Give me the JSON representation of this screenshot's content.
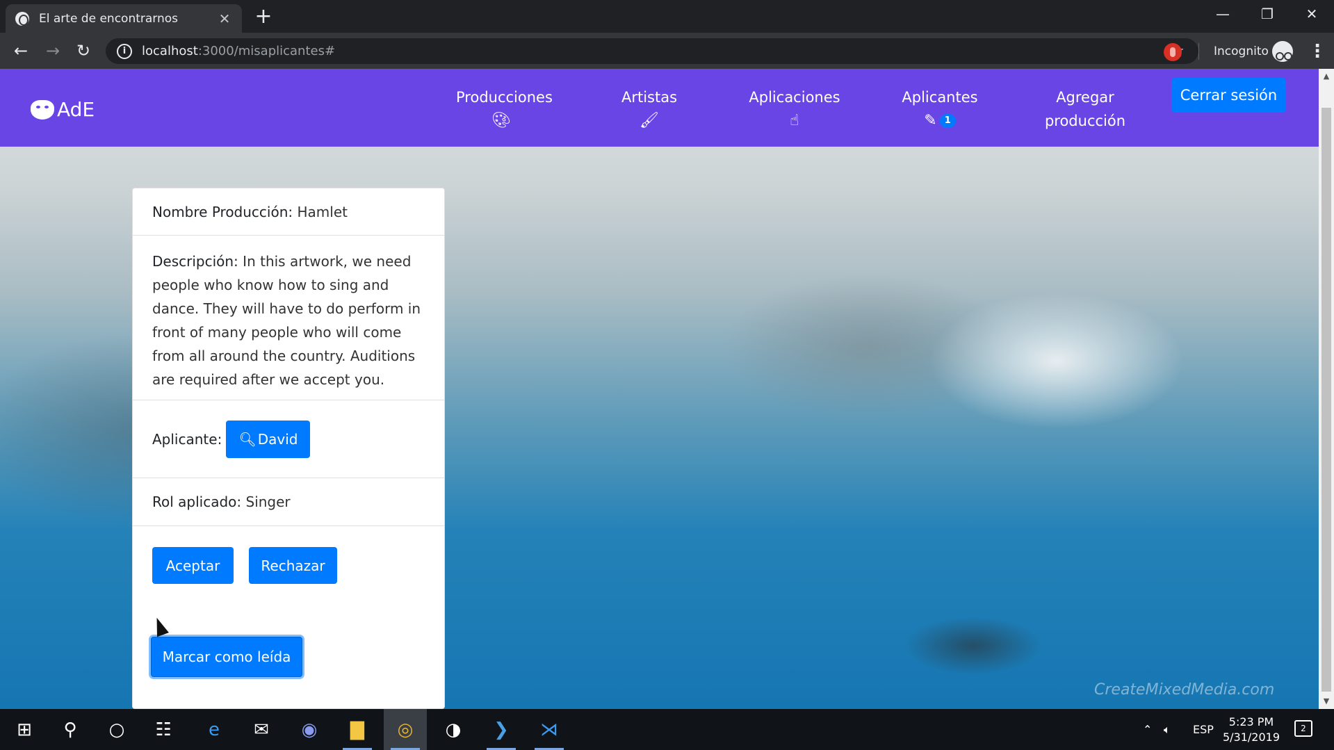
{
  "browser": {
    "tab_title": "El arte de encontrarnos",
    "url_host": "localhost",
    "url_path": ":3000/misaplicantes#",
    "incognito_label": "Incognito"
  },
  "app": {
    "brand": "AdE",
    "nav": [
      {
        "label": "Producciones",
        "icon": "palette-icon"
      },
      {
        "label": "Artistas",
        "icon": "brush-icon"
      },
      {
        "label": "Aplicaciones",
        "icon": "hand-pointer-icon"
      },
      {
        "label": "Aplicantes",
        "icon": "paint-brush-icon",
        "badge": "1"
      },
      {
        "label_line1": "Agregar",
        "label_line2": "producción"
      }
    ],
    "logout_label": "Cerrar sesión",
    "colors": {
      "navbar": "#6a45e6",
      "primary": "#007bff"
    }
  },
  "card": {
    "name_label": "Nombre Producción:",
    "name_value": "Hamlet",
    "desc_label": "Descripción:",
    "desc_value": "In this artwork, we need people who know how to sing and dance. They will have to do perform in front of many people who will come from all around the country. Auditions are required after we accept you.",
    "applicant_label": "Aplicante:",
    "applicant_button": "David",
    "role_label": "Rol aplicado:",
    "role_value": "Singer",
    "accept_label": "Aceptar",
    "reject_label": "Rechazar",
    "mark_read_label": "Marcar como leída"
  },
  "watermark": "CreateMixedMedia.com",
  "taskbar": {
    "language": "ESP",
    "time": "5:23 PM",
    "date": "5/31/2019",
    "notifications": "2"
  }
}
